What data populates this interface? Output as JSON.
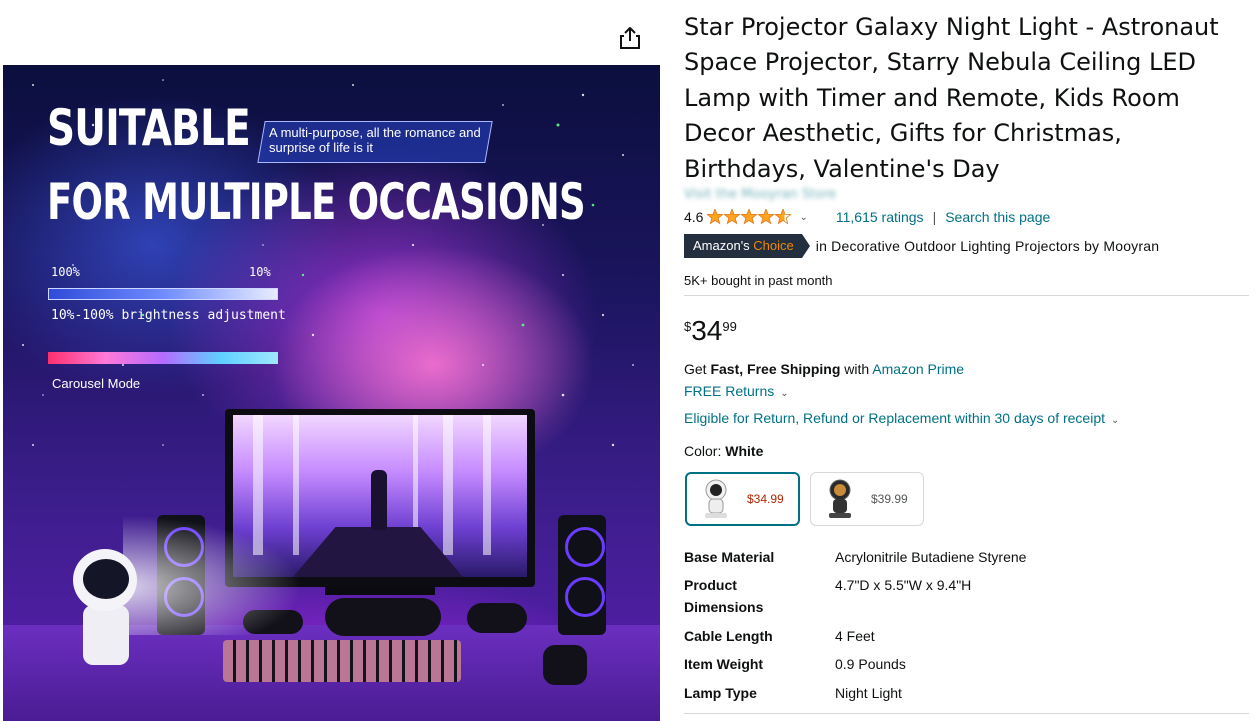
{
  "hero": {
    "headline_1": "SUITABLE",
    "headline_2": "FOR MULTIPLE OCCASIONS",
    "callout": "A multi-purpose, all the romance and surprise of life is it",
    "bar_left": "100%",
    "bar_right": "10%",
    "brightness_label": "10%-100% brightness adjustment",
    "carousel_label": "Carousel Mode"
  },
  "product": {
    "title": "Star Projector Galaxy Night Light - Astronaut Space Projector, Starry Nebula Ceiling LED Lamp with Timer and Remote, Kids Room Decor Aesthetic, Gifts for Christmas, Birthdays, Valentine's Day",
    "store_link": "Visit the Mooyran Store",
    "rating": "4.6",
    "rating_value": 4.6,
    "ratings_count": "11,615 ratings",
    "separator": "|",
    "search_page": "Search this page",
    "badge_prefix": "Amazon's",
    "badge_accent": "Choice",
    "badge_context": "in Decorative Outdoor Lighting Projectors by Mooyran",
    "bought": "5K+ bought in past month"
  },
  "price": {
    "symbol": "$",
    "whole": "34",
    "fraction": "99"
  },
  "shipping": {
    "prefix": "Get ",
    "bold": "Fast, Free Shipping",
    "middle": " with ",
    "prime_link": "Amazon Prime",
    "free_returns": "FREE Returns",
    "eligible": "Eligible for Return, Refund or Replacement within 30 days of receipt"
  },
  "color": {
    "label": "Color:",
    "value": "White",
    "options": [
      {
        "price": "$34.99",
        "selected": true
      },
      {
        "price": "$39.99",
        "selected": false
      }
    ]
  },
  "specs": [
    {
      "key": "Base Material",
      "value": "Acrylonitrile Butadiene Styrene"
    },
    {
      "key": "Product Dimensions",
      "value": "4.7\"D x 5.5\"W x 9.4\"H"
    },
    {
      "key": "Cable Length",
      "value": "4 Feet"
    },
    {
      "key": "Item Weight",
      "value": "0.9 Pounds"
    },
    {
      "key": "Lamp Type",
      "value": "Night Light"
    }
  ],
  "colors": {
    "link": "#007185",
    "price_red": "#b12704",
    "star": "#ffa41c",
    "badge_bg": "#232f3e",
    "badge_accent": "#f08804"
  }
}
